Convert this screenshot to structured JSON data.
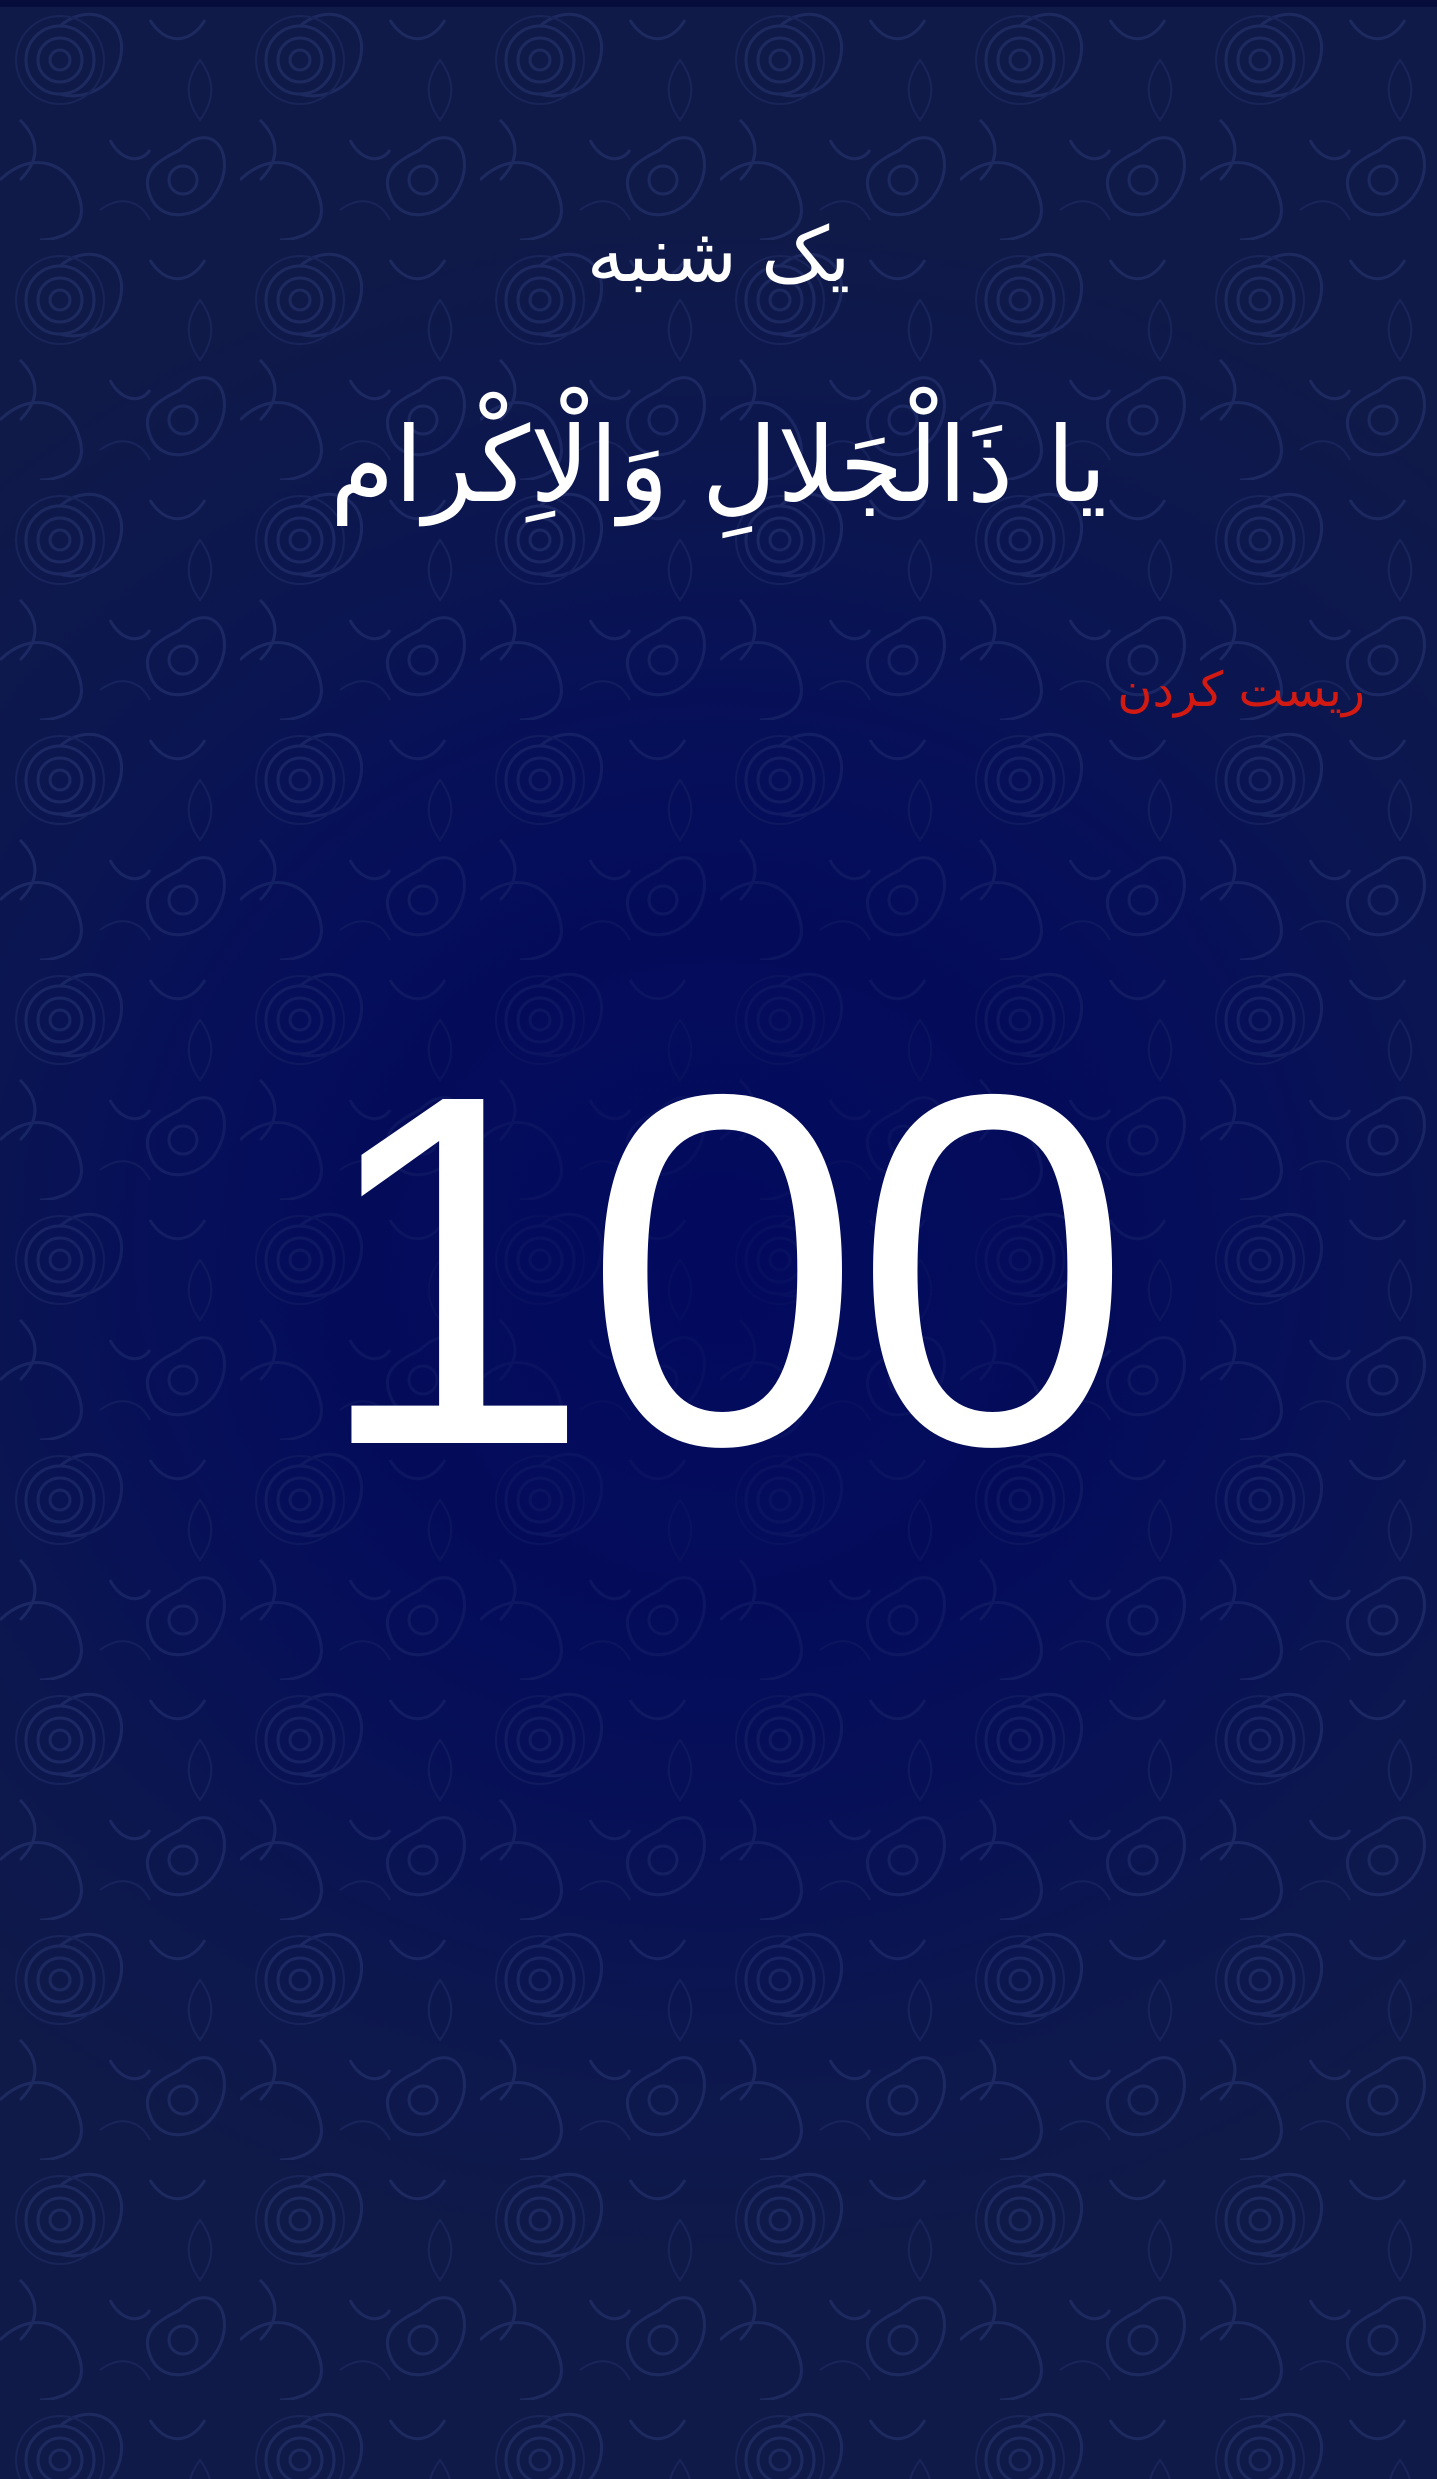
{
  "header": {
    "day_title": "یک شنبه",
    "zikr": "یا ذَالْجَلالِ وَالْاِکْرام"
  },
  "controls": {
    "reset_label": "ریست کردن"
  },
  "counter": {
    "value": "100"
  },
  "colors": {
    "background": "#06105a",
    "text": "#ffffff",
    "reset": "#d21a12"
  }
}
